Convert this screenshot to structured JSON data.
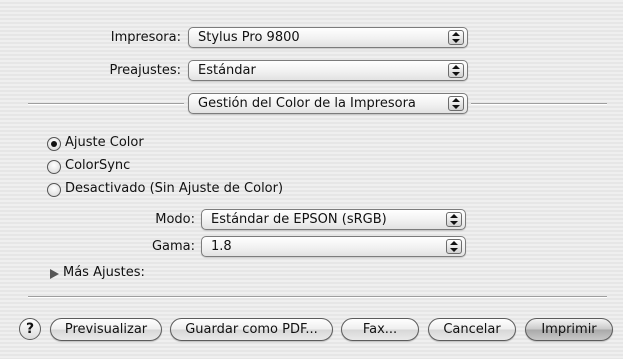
{
  "printer": {
    "label": "Impresora:",
    "value": "Stylus Pro 9800"
  },
  "presets": {
    "label": "Preajustes:",
    "value": "Estándar"
  },
  "panel": {
    "value": "Gestión del Color de la Impresora"
  },
  "color_options": [
    {
      "label": "Ajuste Color",
      "selected": true
    },
    {
      "label": "ColorSync",
      "selected": false
    },
    {
      "label": "Desactivado (Sin Ajuste de Color)",
      "selected": false
    }
  ],
  "mode": {
    "label": "Modo:",
    "value": "Estándar de EPSON (sRGB)"
  },
  "gamma": {
    "label": "Gama:",
    "value": "1.8"
  },
  "more_settings": {
    "label": "Más Ajustes:"
  },
  "buttons": {
    "help": "?",
    "preview": "Previsualizar",
    "save_pdf": "Guardar como PDF...",
    "fax": "Fax...",
    "cancel": "Cancelar",
    "print": "Imprimir"
  },
  "icons": {
    "popup_arrows": "up-down-arrows-icon",
    "disclosure": "disclosure-triangle-icon"
  }
}
